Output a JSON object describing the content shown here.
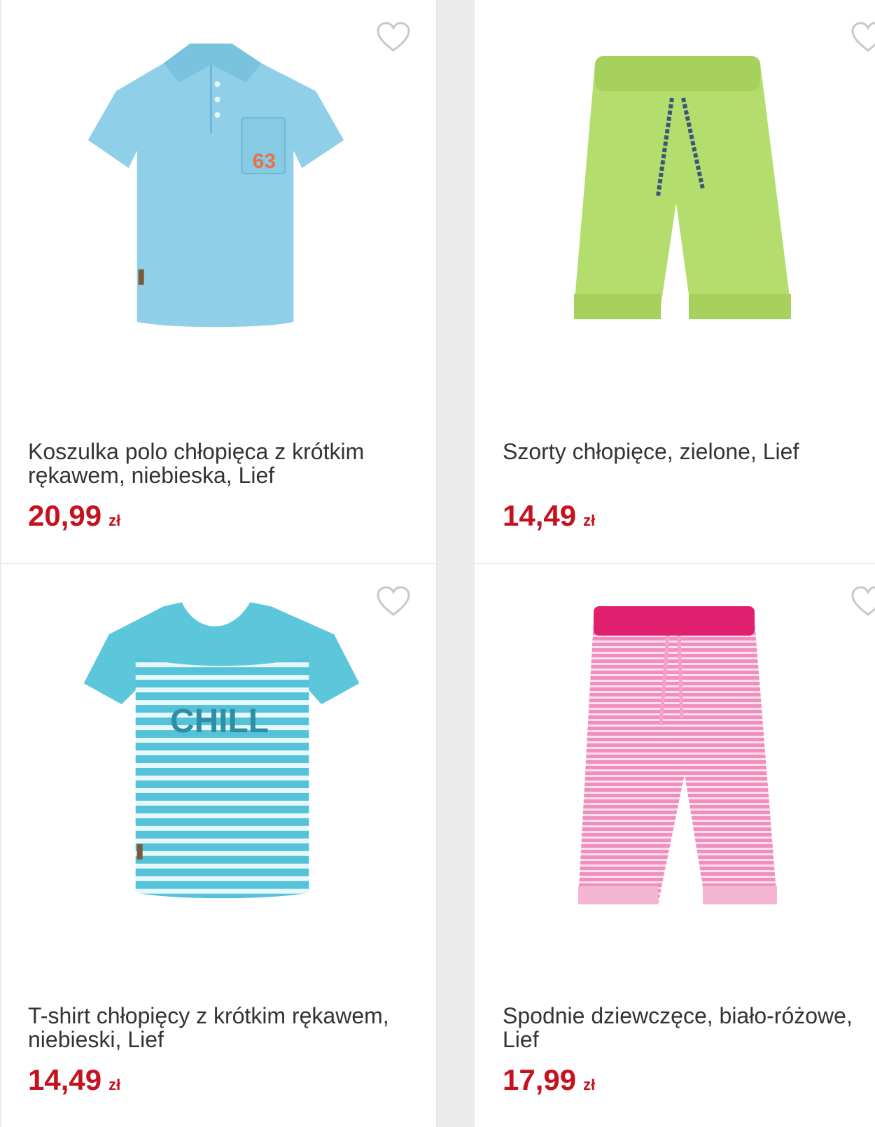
{
  "products": [
    {
      "title": "Koszulka polo chłopięca z krótkim rękawem, niebieska, Lief",
      "price": "20,99",
      "currency": "zł",
      "image_icon": "polo-shirt-image",
      "color": "#8fd0e8"
    },
    {
      "title": "Szorty chłopięce, zielone, Lief",
      "price": "14,49",
      "currency": "zł",
      "image_icon": "shorts-image",
      "color": "#b3dd6c"
    },
    {
      "title": "T-shirt chłopięcy z krótkim rękawem, niebieski, Lief",
      "price": "14,49",
      "currency": "zł",
      "image_icon": "tshirt-image",
      "color": "#54c2d8",
      "print_text": "CHILL"
    },
    {
      "title": "Spodnie dziewczęce, biało-różowe, Lief",
      "price": "17,99",
      "currency": "zł",
      "image_icon": "pants-image",
      "color": "#f08fbd"
    }
  ],
  "theme": {
    "price_color": "#c5121f",
    "heart_color": "#c8c8c8"
  }
}
